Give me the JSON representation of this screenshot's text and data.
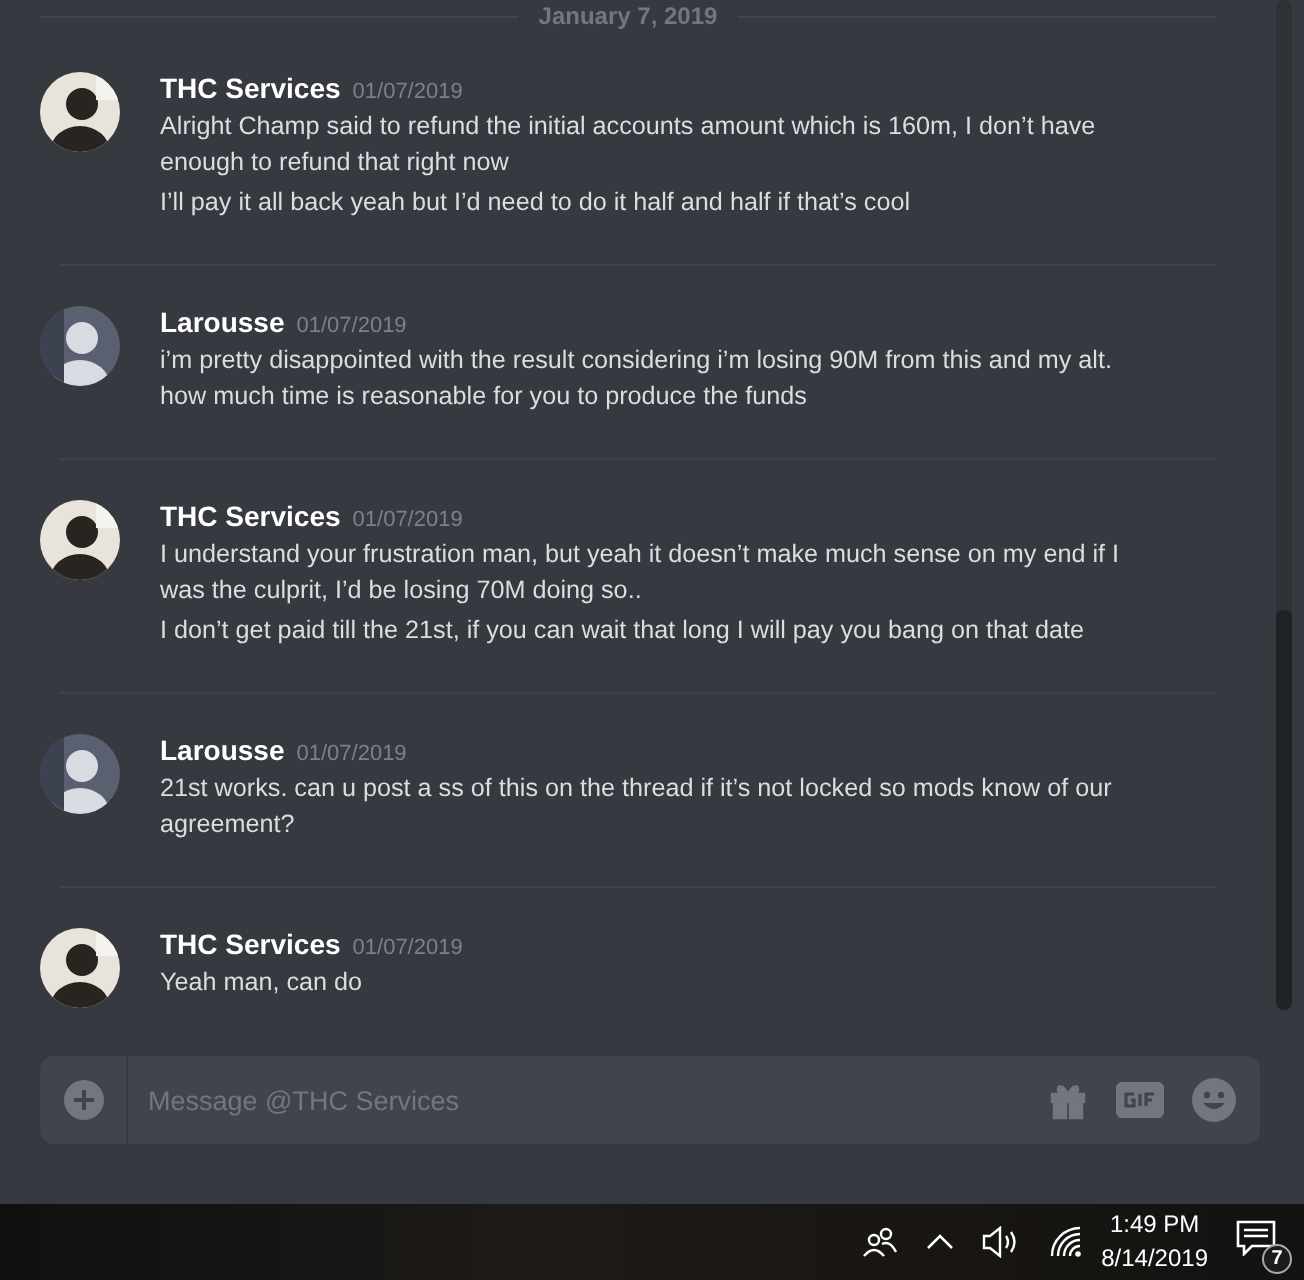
{
  "date_divider": "January 7, 2019",
  "messages": [
    {
      "author": "THC Services",
      "timestamp": "01/07/2019",
      "avatar": {
        "kind": "picture"
      },
      "paragraphs": [
        "Alright Champ said to refund the initial accounts amount which is 160m, I don’t have enough to refund that right now",
        "I’ll pay it all back yeah but I’d need to do it half and half if that’s cool"
      ]
    },
    {
      "author": "Larousse",
      "timestamp": "01/07/2019",
      "avatar": {
        "kind": "picture"
      },
      "paragraphs": [
        "i’m pretty disappointed with the result considering i’m losing 90M from this and my alt. how much time is reasonable for you to produce the funds"
      ]
    },
    {
      "author": "THC Services",
      "timestamp": "01/07/2019",
      "avatar": {
        "kind": "picture"
      },
      "paragraphs": [
        "I understand your frustration man, but yeah it doesn’t make much sense on my end if I was the culprit, I’d be losing 70M doing so..",
        "I don’t get paid till the 21st, if you can wait that long I will pay you bang on that date"
      ]
    },
    {
      "author": "Larousse",
      "timestamp": "01/07/2019",
      "avatar": {
        "kind": "picture"
      },
      "paragraphs": [
        "21st works. can u post a ss of this on the thread if it’s not locked so mods know of our agreement?"
      ]
    },
    {
      "author": "THC Services",
      "timestamp": "01/07/2019",
      "avatar": {
        "kind": "picture"
      },
      "paragraphs": [
        "Yeah man, can do"
      ]
    }
  ],
  "composer": {
    "placeholder": "Message @THC Services"
  },
  "taskbar": {
    "time": "1:49 PM",
    "date": "8/14/2019",
    "notification_count": "7"
  }
}
